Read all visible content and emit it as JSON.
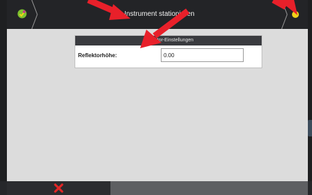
{
  "titlebar": {
    "title": "Instrument stationieren",
    "app_icon": "app-logo-icon",
    "status_color": "#f0d11a"
  },
  "panel": {
    "header": "Reflektor-Einstellungen",
    "rows": [
      {
        "label": "Reflektorhöhe:",
        "value": "0.00"
      }
    ]
  },
  "bottombar": {
    "cancel_icon": "close-icon",
    "cancel_color": "#e32626"
  },
  "annotations": {
    "arrow_color": "#e8202a",
    "arrows": [
      "arrow-to-title",
      "arrow-to-field",
      "arrow-to-status"
    ]
  }
}
